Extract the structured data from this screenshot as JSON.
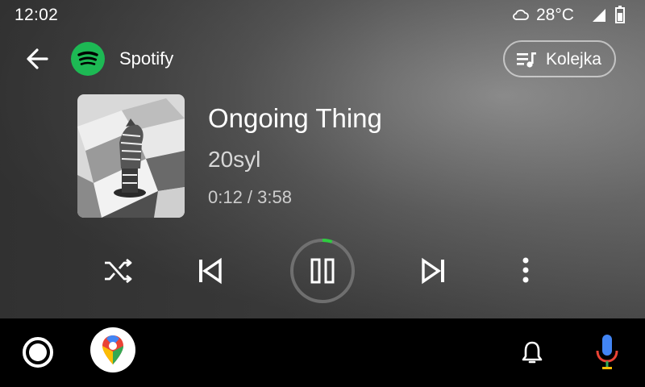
{
  "status_bar": {
    "time": "12:02",
    "temperature": "28°C",
    "weather_icon": "cloud-icon",
    "signal_icon": "cell-signal-icon",
    "battery_icon": "battery-icon"
  },
  "header": {
    "app_name": "Spotify",
    "back_icon": "arrow-back-icon",
    "queue_label": "Kolejka",
    "queue_icon": "queue-music-icon"
  },
  "now_playing": {
    "title": "Ongoing Thing",
    "artist": "20syl",
    "elapsed": "0:12",
    "duration": "3:58",
    "time_display": "0:12 / 3:58",
    "progress_fraction": 0.05
  },
  "controls": {
    "shuffle_icon": "shuffle-icon",
    "previous_icon": "skip-previous-icon",
    "pause_icon": "pause-icon",
    "next_icon": "skip-next-icon",
    "more_icon": "more-vertical-icon"
  },
  "nav_bar": {
    "home_icon": "home-circle-icon",
    "maps_icon": "google-maps-icon",
    "notifications_icon": "bell-icon",
    "assistant_icon": "microphone-icon"
  },
  "colors": {
    "spotify_green": "#1DB954",
    "progress_green": "#2ecc40",
    "mic_blue": "#4285F4",
    "mic_red": "#EA4335"
  }
}
